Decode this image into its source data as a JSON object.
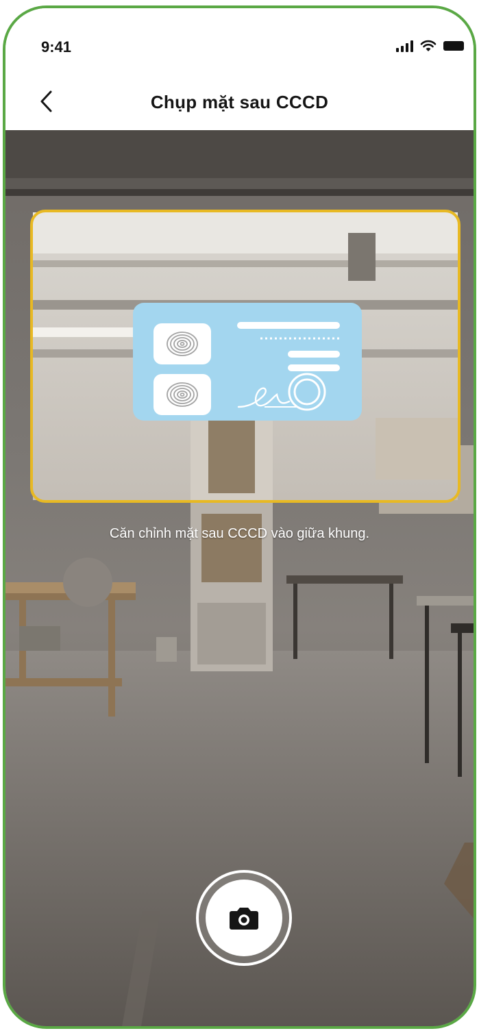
{
  "status_bar": {
    "time": "9:41",
    "signal_icon": "signal-icon",
    "wifi_icon": "wifi-icon",
    "battery_icon": "battery-icon"
  },
  "nav": {
    "back_icon": "chevron-left-icon",
    "title": "Chụp mặt sau CCCD"
  },
  "camera": {
    "frame_color": "#e8b923",
    "hint": "Căn chỉnh mặt sau CCCD vào giữa khung.",
    "card_color": "#a3d6ef",
    "card_icons": [
      "fingerprint-icon",
      "fingerprint-icon",
      "signature-icon",
      "seal-icon"
    ],
    "shutter_icon": "camera-icon"
  },
  "colors": {
    "accent_border": "#5aa845",
    "frame": "#e8b923",
    "card": "#a3d6ef"
  }
}
